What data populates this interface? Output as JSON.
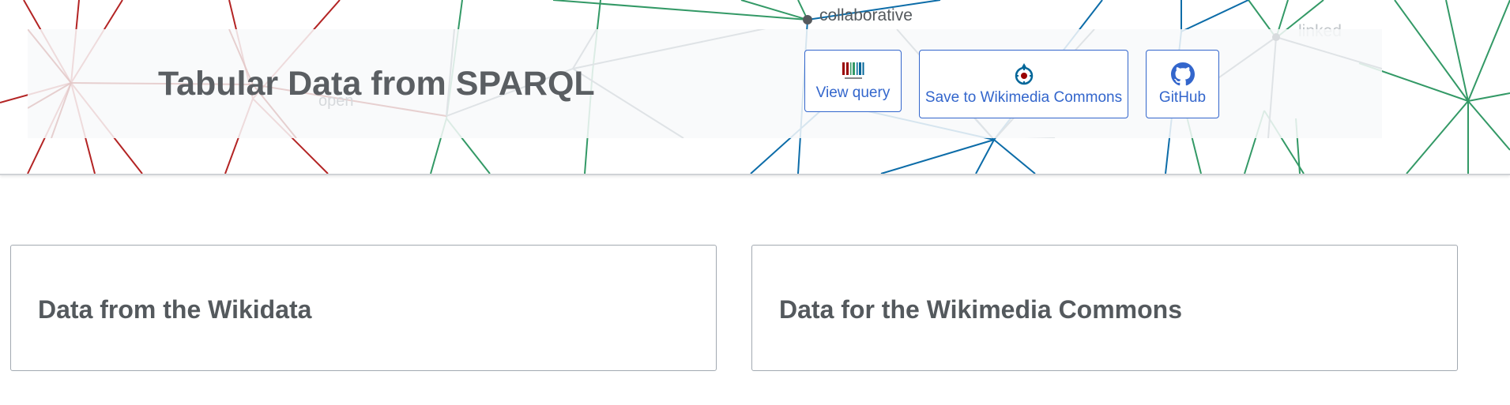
{
  "header": {
    "title": "Tabular Data from SPARQL",
    "background_words": {
      "collaborative": "collaborative",
      "linked": "linked",
      "open": "open"
    },
    "buttons": {
      "view_query": {
        "label": "View query",
        "icon": "wikidata-barcode-icon"
      },
      "save_commons": {
        "label": "Save to Wikimedia Commons",
        "icon": "wikimedia-commons-icon"
      },
      "github": {
        "label": "GitHub",
        "icon": "github-octocat-icon"
      }
    }
  },
  "cards": {
    "left": {
      "title": "Data from the Wikidata"
    },
    "right": {
      "title": "Data for the Wikimedia Commons"
    }
  },
  "colors": {
    "accent": "#3366cc",
    "red_lines": "#b32424",
    "green_lines": "#339966",
    "blue_lines": "#0c6ca8",
    "node": "#54595d"
  }
}
